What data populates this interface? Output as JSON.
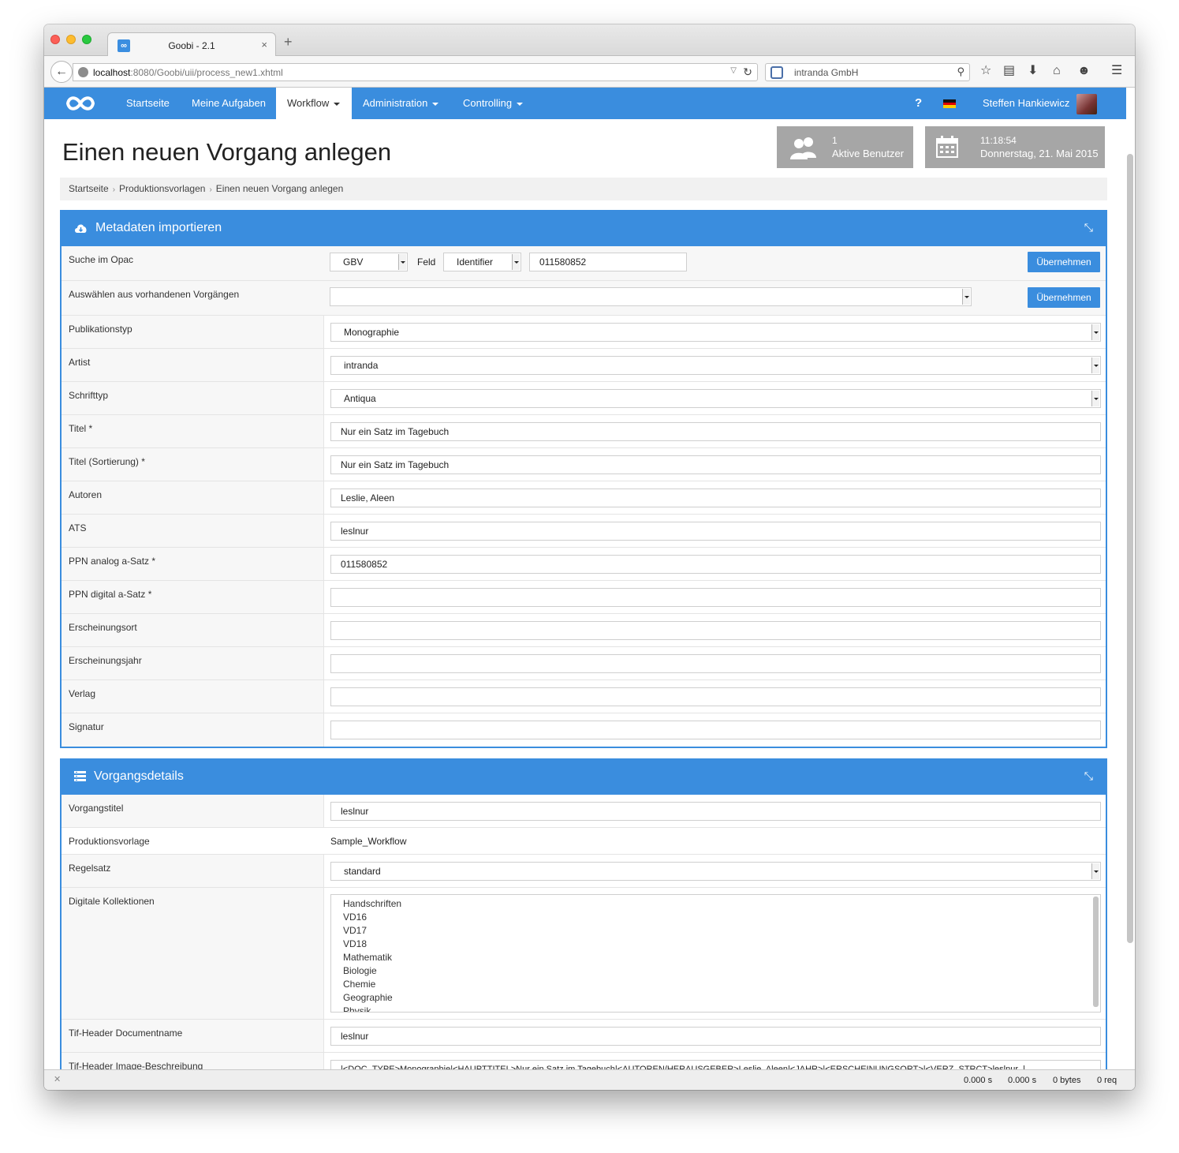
{
  "browser": {
    "tab_title": "Goobi - 2.1",
    "url_host": "localhost",
    "url_rest": ":8080/Goobi/uii/process_new1.xhtml",
    "search_text": "intranda GmbH"
  },
  "appnav": {
    "items": [
      "Startseite",
      "Meine Aufgaben",
      "Workflow",
      "Administration",
      "Controlling"
    ],
    "help": "?",
    "username": "Steffen Hankiewicz"
  },
  "header": {
    "title": "Einen neuen Vorgang anlegen",
    "users_count": "1",
    "users_label": "Aktive Benutzer",
    "time": "11:18:54",
    "date": "Donnerstag, 21. Mai 2015"
  },
  "breadcrumb": [
    "Startseite",
    "Produktionsvorlagen",
    "Einen neuen Vorgang anlegen"
  ],
  "import_panel": {
    "title": "Metadaten importieren",
    "opac": {
      "label": "Suche im Opac",
      "catalog": "GBV",
      "field_label": "Feld",
      "field": "Identifier",
      "value": "011580852",
      "button": "Übernehmen"
    },
    "existing": {
      "label": "Auswählen aus vorhandenen Vorgängen",
      "value": "",
      "button": "Übernehmen"
    },
    "selects": [
      {
        "label": "Publikationstyp",
        "value": "Monographie"
      },
      {
        "label": "Artist",
        "value": "intranda"
      },
      {
        "label": "Schrifttyp",
        "value": "Antiqua"
      }
    ],
    "fields": [
      {
        "label": "Titel *",
        "value": "Nur ein Satz im Tagebuch"
      },
      {
        "label": "Titel (Sortierung) *",
        "value": "Nur ein Satz im Tagebuch"
      },
      {
        "label": "Autoren",
        "value": "Leslie, Aleen"
      },
      {
        "label": "ATS",
        "value": "leslnur"
      },
      {
        "label": "PPN analog a-Satz *",
        "value": "011580852"
      },
      {
        "label": "PPN digital a-Satz *",
        "value": ""
      },
      {
        "label": "Erscheinungsort",
        "value": ""
      },
      {
        "label": "Erscheinungsjahr",
        "value": ""
      },
      {
        "label": "Verlag",
        "value": ""
      },
      {
        "label": "Signatur",
        "value": ""
      }
    ]
  },
  "details_panel": {
    "title": "Vorgangsdetails",
    "process_title_label": "Vorgangstitel",
    "process_title": "leslnur",
    "template_label": "Produktionsvorlage",
    "template": "Sample_Workflow",
    "ruleset_label": "Regelsatz",
    "ruleset": "standard",
    "collections_label": "Digitale Kollektionen",
    "collections": [
      "Handschriften",
      "VD16",
      "VD17",
      "VD18",
      "Mathematik",
      "Biologie",
      "Chemie",
      "Geographie",
      "Physik"
    ],
    "tif_doc_label": "Tif-Header Documentname",
    "tif_doc": "leslnur",
    "tif_img_label": "Tif-Header Image-Beschreibung",
    "tif_img": "|<DOC_TYPE>Monographie|<HAUPTTITEL>Nur ein Satz im Tagebuch|<AUTOREN/HERAUSGEBER>Leslie, Aleen|<JAHR>|<ERSCHEINUNGSORT>|<VERZ_STRCT>leslnur_|"
  },
  "status": {
    "t1": "0.000 s",
    "t2": "0.000 s",
    "bytes": "0 bytes",
    "req": "0 req"
  },
  "colors": {
    "accent": "#3a8dde",
    "info_box": "#a6a6a6"
  }
}
